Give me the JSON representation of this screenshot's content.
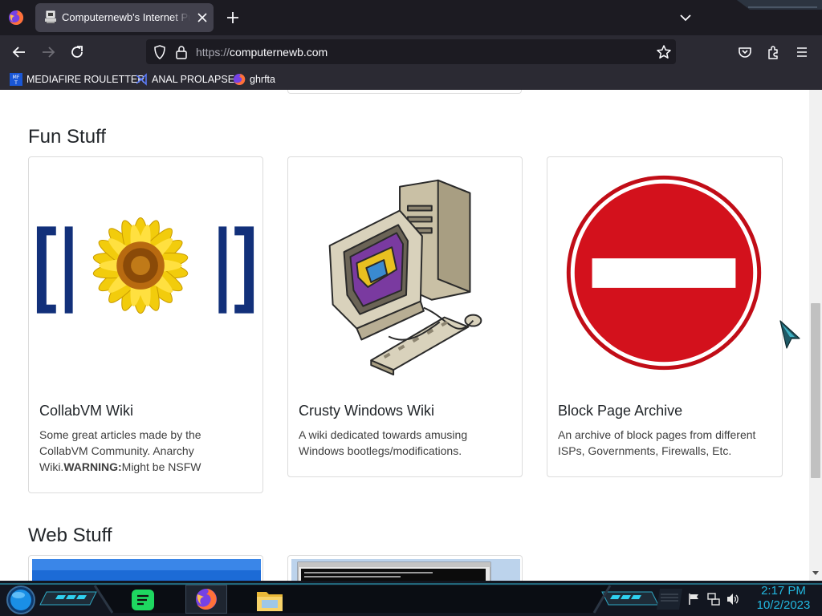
{
  "browser": {
    "tab": {
      "title": "Computernewb's Internet Pub Hub"
    },
    "url": {
      "protocol": "https://",
      "host": "computernewb.com"
    },
    "bookmarks": [
      {
        "label": "MEDIAFIRE ROULETTER",
        "icon": "mediafire-icon"
      },
      {
        "label": "ANAL PROLAPSE",
        "icon": "visual-studio-icon"
      },
      {
        "label": "ghrfta",
        "icon": "firefox-icon"
      }
    ]
  },
  "sections": {
    "fun_stuff": {
      "title": "Fun Stuff",
      "cards": [
        {
          "title": "CollabVM Wiki",
          "text_before": "Some great articles made by the CollabVM Community. Anarchy Wiki.",
          "text_bold": "WARNING:",
          "text_after": "Might be NSFW",
          "image": "sunflower-logo"
        },
        {
          "title": "Crusty Windows Wiki",
          "text": "A wiki dedicated towards amusing Windows bootlegs/modifications.",
          "image": "crusty-computer"
        },
        {
          "title": "Block Page Archive",
          "text": "An archive of block pages from different ISPs, Governments, Firewalls, Etc.",
          "image": "no-entry-sign"
        }
      ]
    },
    "web_stuff": {
      "title": "Web Stuff"
    }
  },
  "taskbar": {
    "time": "2:17 PM",
    "date": "10/2/2023",
    "apps": [
      "start-orb",
      "spotify-icon",
      "firefox-icon",
      "file-explorer-icon"
    ],
    "tray": [
      "flag-icon",
      "network-icon",
      "volume-icon"
    ]
  },
  "colors": {
    "accent": "#22b8e0",
    "toolbar": "#2b2a33",
    "tabstrip": "#1c1b22",
    "sign_red": "#d3111c"
  }
}
